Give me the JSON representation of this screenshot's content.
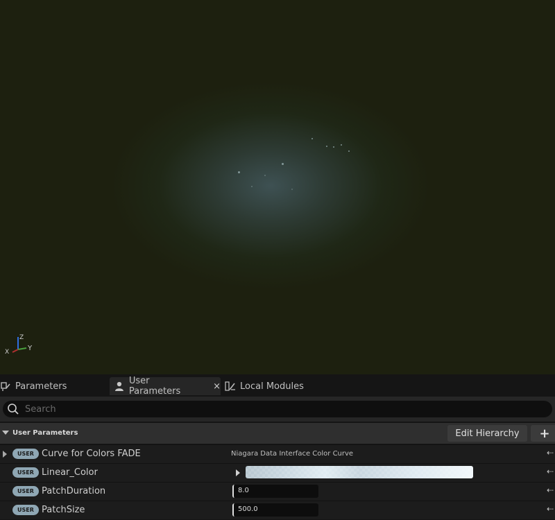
{
  "viewport": {
    "axis": {
      "x": "X",
      "y": "Y",
      "z": "Z"
    }
  },
  "tabs": [
    {
      "label": "Parameters",
      "icon": "parameters-icon"
    },
    {
      "label": "User Parameters",
      "icon": "user-icon",
      "close": "×"
    },
    {
      "label": "Local Modules",
      "icon": "local-modules-icon"
    }
  ],
  "search": {
    "placeholder": "Search",
    "value": ""
  },
  "section": {
    "title": "User Parameters",
    "edit_hierarchy": "Edit Hierarchy",
    "add": "+"
  },
  "rows": [
    {
      "badge": "USER",
      "name": "Curve for Colors FADE",
      "type": "Niagara Data Interface Color Curve"
    },
    {
      "badge": "USER",
      "name": "Linear_Color"
    },
    {
      "badge": "USER",
      "name": "PatchDuration",
      "value": "8.0"
    },
    {
      "badge": "USER",
      "name": "PatchSize",
      "value": "500.0"
    }
  ],
  "reset_glyph": "⇠",
  "colors": {
    "badge": "#8fa7b4",
    "viewport_bg": "#1d200f",
    "glow": "#3e5153"
  }
}
